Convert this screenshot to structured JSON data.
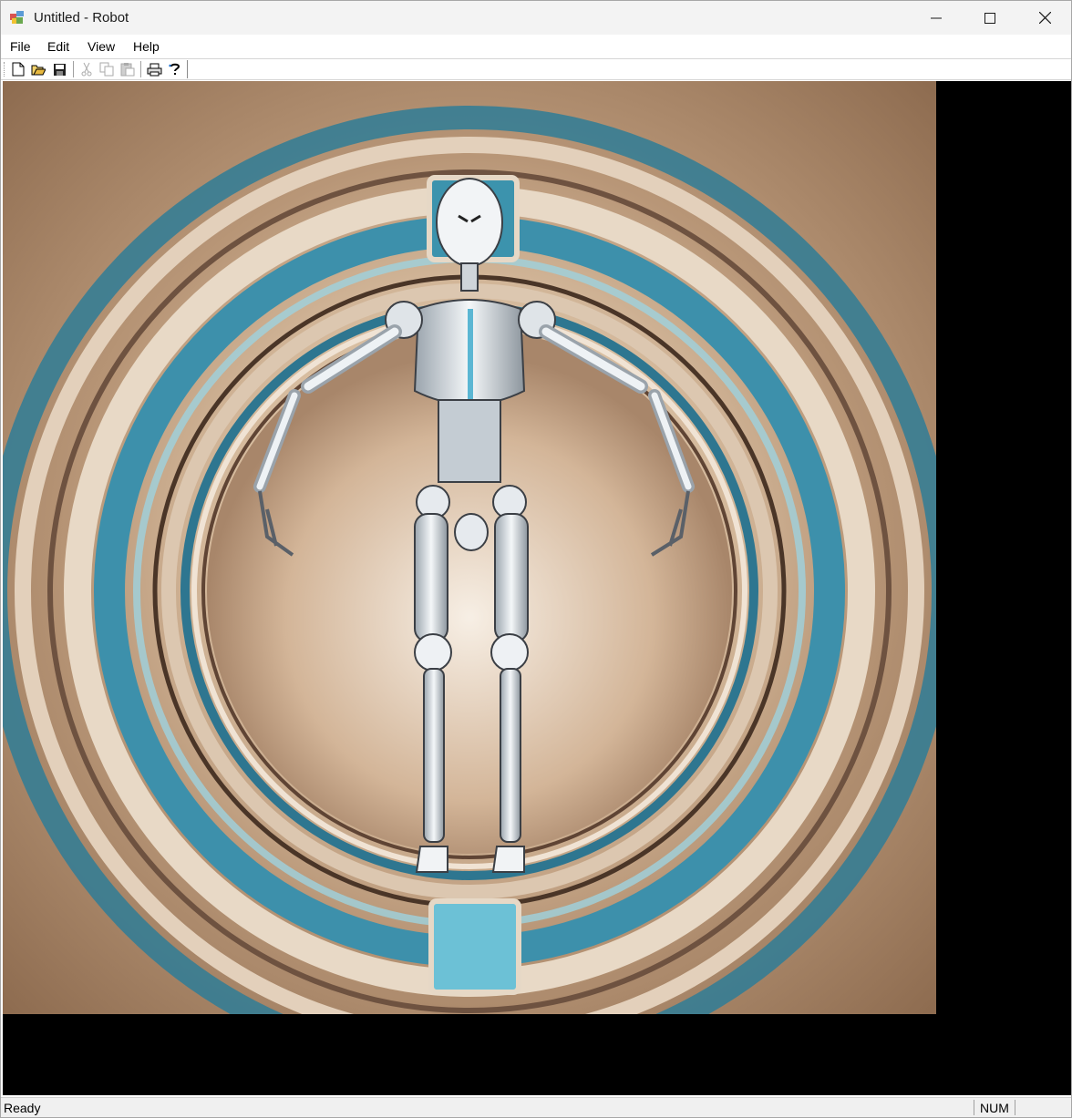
{
  "window": {
    "title": "Untitled - Robot"
  },
  "menu": {
    "items": [
      "File",
      "Edit",
      "View",
      "Help"
    ]
  },
  "toolbar": {
    "buttons": [
      "new-icon",
      "open-icon",
      "save-icon",
      "cut-icon",
      "copy-icon",
      "paste-icon",
      "print-icon",
      "help-icon"
    ]
  },
  "canvas": {
    "image_subject": "robot-figure-on-circular-backdrop",
    "colors": {
      "teal": "#3f8fa8",
      "beige": "#c9ab8a",
      "background": "#000000"
    }
  },
  "status": {
    "text": "Ready",
    "num": "NUM"
  }
}
